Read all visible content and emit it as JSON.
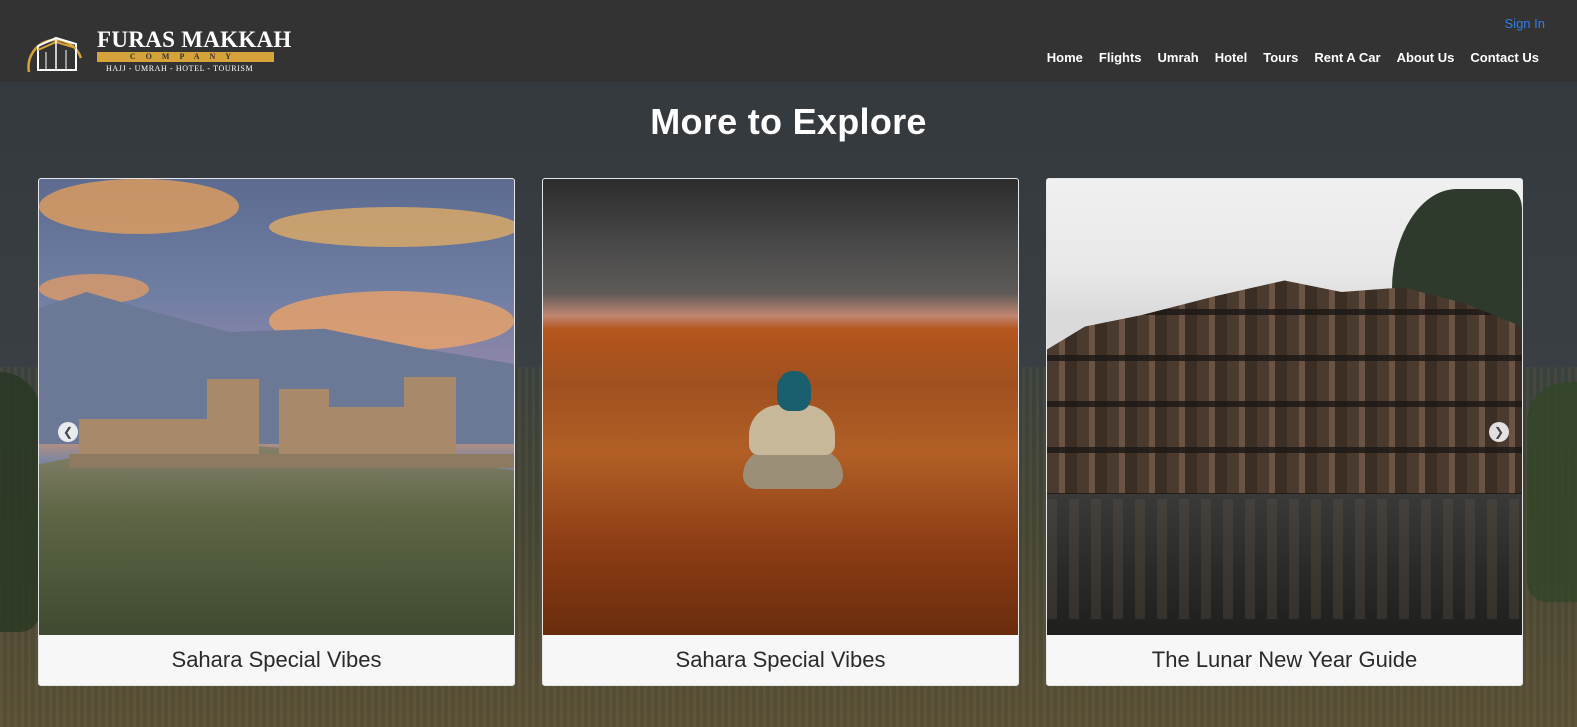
{
  "header": {
    "logo": {
      "title": "FURAS MAKKAH",
      "band": "COMPANY",
      "tagline": "HAJJ - UMRAH - HOTEL - TOURISM"
    },
    "sign_in": "Sign In",
    "nav": [
      "Home",
      "Flights",
      "Umrah",
      "Hotel",
      "Tours",
      "Rent A Car",
      "About Us",
      "Contact Us"
    ]
  },
  "section": {
    "title": "More to Explore",
    "cards": [
      {
        "caption": "Sahara Special Vibes"
      },
      {
        "caption": "Sahara Special Vibes"
      },
      {
        "caption": "The Lunar New Year Guide"
      }
    ],
    "prev_icon": "chevron-left-icon",
    "next_icon": "chevron-right-icon"
  },
  "colors": {
    "header_bg": "#333333",
    "sign_in": "#2f7fe6",
    "logo_gold": "#d6a33b",
    "card_bg": "#f8f8f8"
  }
}
